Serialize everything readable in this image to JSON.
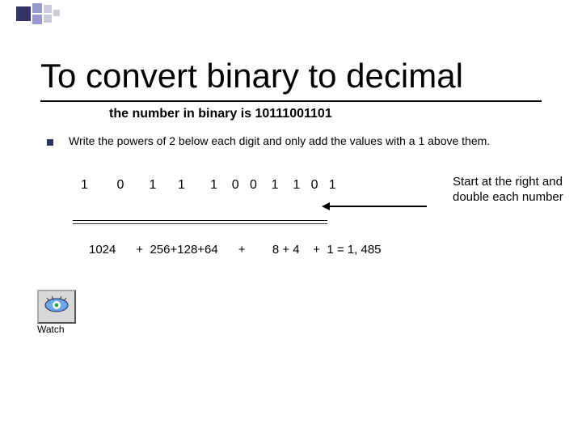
{
  "title": "To convert binary to decimal",
  "subtitle": "the number in binary is 10111001101",
  "bullet": "Write the powers of 2 below each digit and only add the values with a 1 above them.",
  "digits_row": "1        0       1      1       1    0   0    1    1   0   1",
  "calc_row": "1024      +  256+128+64      +        8 + 4    +  1 = 1, 485",
  "side_note": "Start at the right and double each number",
  "watch_label": "Watch"
}
